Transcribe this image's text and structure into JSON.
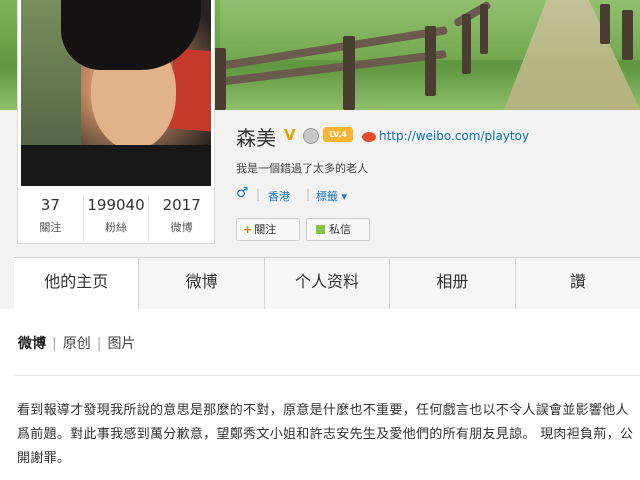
{
  "profile": {
    "name": "森美",
    "verified_mark": "V",
    "level_badge": "LV.4",
    "weibo_url": "http://weibo.com/playtoy",
    "bio": "我是一個錯過了太多的老人",
    "gender_symbol": "♂",
    "location": "香港",
    "tags_label": "標籤 ▾",
    "stats": {
      "following_count": "37",
      "following_label": "關注",
      "fans_count": "199040",
      "fans_label": "粉絲",
      "posts_count": "2017",
      "posts_label": "微博"
    },
    "follow_button": "關注",
    "message_button": "私信"
  },
  "tabs": [
    "他的主页",
    "微博",
    "个人资料",
    "相册",
    "讚"
  ],
  "filters": [
    "微博",
    "原创",
    "图片"
  ],
  "post": {
    "text": "看到報導才發現我所說的意思是那麼的不對，原意是什麼也不重要，任何戲言也以不令人誤會並影響他人爲前題。對此事我感到萬分歉意，望鄭秀文小姐和許志安先生及愛他們的所有朋友見諒。 現肉袒負荊，公開謝罪。"
  }
}
